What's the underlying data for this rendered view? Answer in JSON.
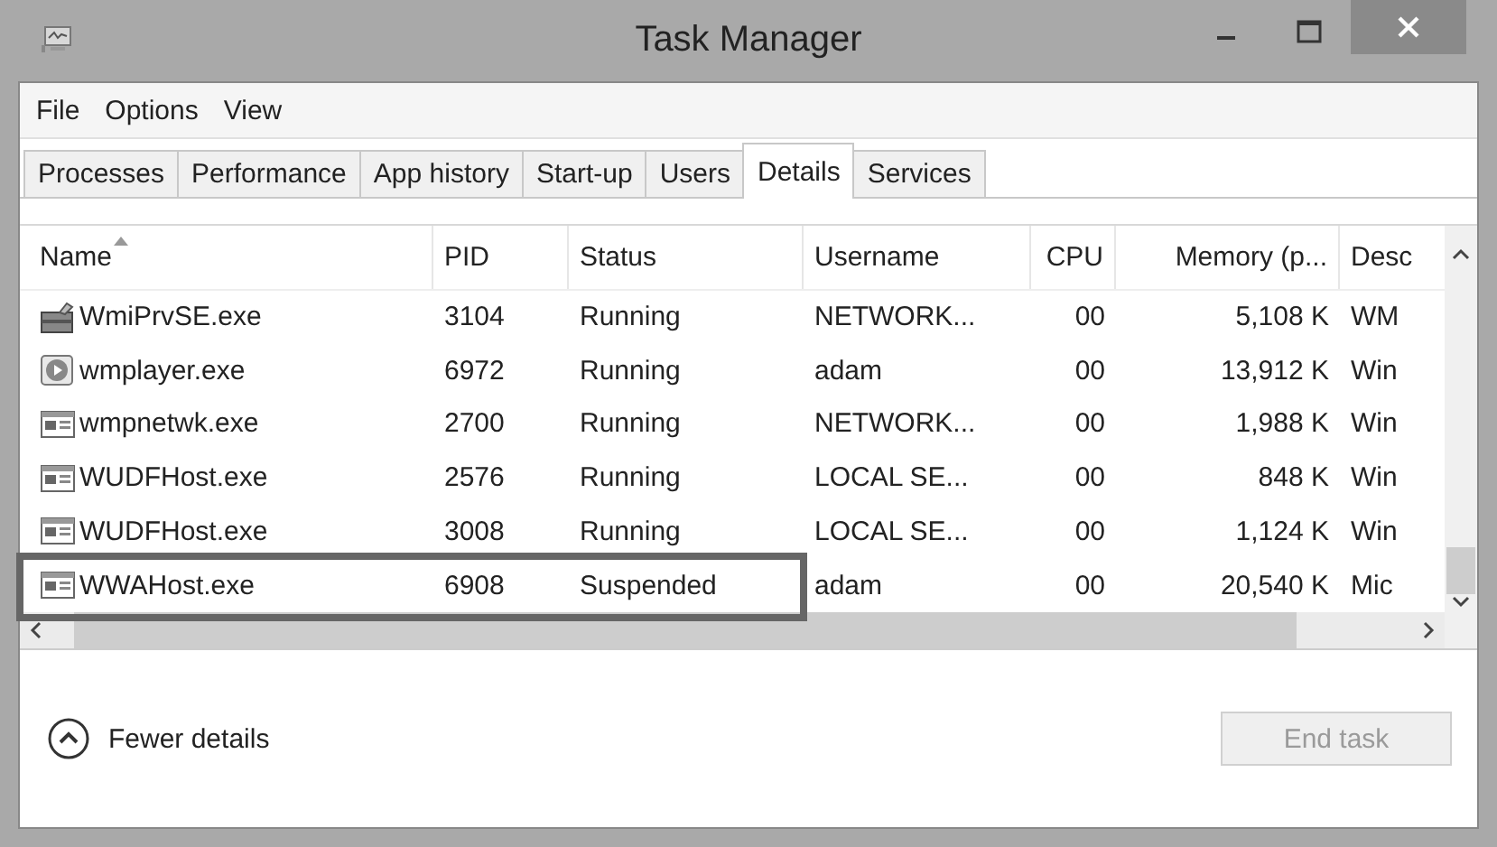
{
  "window": {
    "title": "Task Manager"
  },
  "menu": [
    "File",
    "Options",
    "View"
  ],
  "tabs": [
    {
      "label": "Processes",
      "selected": false
    },
    {
      "label": "Performance",
      "selected": false
    },
    {
      "label": "App history",
      "selected": false
    },
    {
      "label": "Start-up",
      "selected": false
    },
    {
      "label": "Users",
      "selected": false
    },
    {
      "label": "Details",
      "selected": true
    },
    {
      "label": "Services",
      "selected": false
    }
  ],
  "table": {
    "columns": [
      "Name",
      "PID",
      "Status",
      "Username",
      "CPU",
      "Memory (p...",
      "Desc"
    ],
    "rows": [
      {
        "kind": "service",
        "outlined": false,
        "cells": [
          "WmiPrvSE.exe",
          "3104",
          "Running",
          "NETWORK...",
          "00",
          "5,108 K",
          "WM"
        ]
      },
      {
        "kind": "media",
        "outlined": false,
        "cells": [
          "wmplayer.exe",
          "6972",
          "Running",
          "adam",
          "00",
          "13,912 K",
          "Win"
        ]
      },
      {
        "kind": "app",
        "outlined": false,
        "cells": [
          "wmpnetwk.exe",
          "2700",
          "Running",
          "NETWORK...",
          "00",
          "1,988 K",
          "Win"
        ]
      },
      {
        "kind": "app",
        "outlined": false,
        "cells": [
          "WUDFHost.exe",
          "2576",
          "Running",
          "LOCAL SE...",
          "00",
          "848 K",
          "Win"
        ]
      },
      {
        "kind": "app",
        "outlined": false,
        "cells": [
          "WUDFHost.exe",
          "3008",
          "Running",
          "LOCAL SE...",
          "00",
          "1,124 K",
          "Win"
        ]
      },
      {
        "kind": "app",
        "outlined": true,
        "cells": [
          "WWAHost.exe",
          "6908",
          "Suspended",
          "adam",
          "00",
          "20,540 K",
          "Mic"
        ]
      }
    ]
  },
  "footer": {
    "toggle": "Fewer details",
    "button": {
      "label": "End task",
      "disabled": true
    }
  }
}
